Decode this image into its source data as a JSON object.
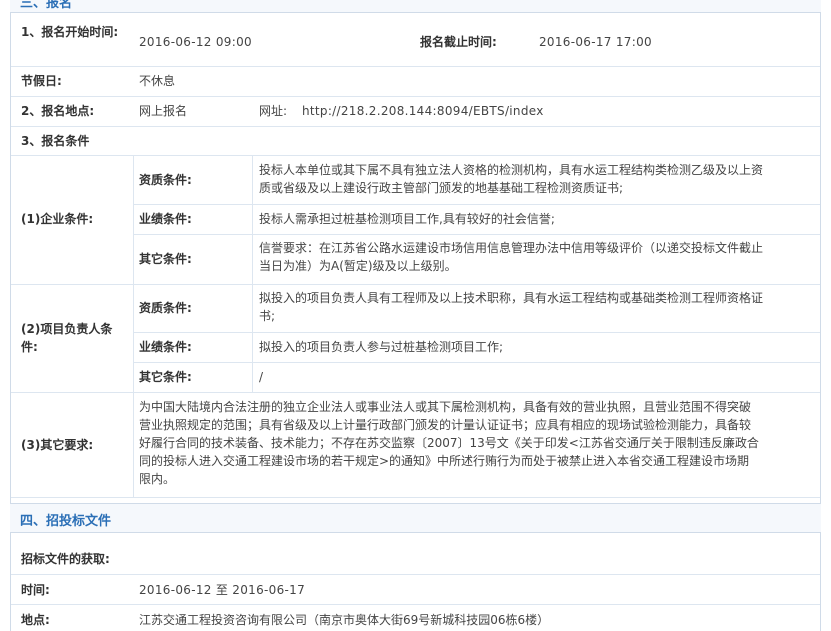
{
  "section3": {
    "title": "三、报名"
  },
  "reg_start": {
    "label": "1、报名开始时间:",
    "value": "2016-06-12 09:00"
  },
  "reg_end": {
    "label": "报名截止时间:",
    "value": "2016-06-17 17:00"
  },
  "holiday": {
    "label": "节假日:",
    "value": "不休息"
  },
  "reg_place": {
    "label": "2、报名地点:",
    "value": "网上报名",
    "url_label": "网址:",
    "url": "http://218.2.208.144:8094/EBTS/index"
  },
  "reg_cond": {
    "label": "3、报名条件"
  },
  "enterprise": {
    "label": "(1)企业条件:",
    "qual_label": "资质条件:",
    "qual_lines": [
      "投标人本单位或其下属不具有独立法人资格的检测机构，具有水运工程结构类检测乙级及以上资",
      "质或省级及以上建设行政主管部门颁发的地基基础工程检测资质证书;"
    ],
    "perf_label": "业绩条件:",
    "perf_value": "投标人需承担过桩基检测项目工作,具有较好的社会信誉;",
    "other_label": "其它条件:",
    "other_lines": [
      "信誉要求：在江苏省公路水运建设市场信用信息管理办法中信用等级评价（以递交投标文件截止",
      "当日为准）为A(暂定)级及以上级别。"
    ]
  },
  "manager": {
    "label_lines": [
      "(2)项目负责人条",
      "件:"
    ],
    "qual_label": "资质条件:",
    "qual_lines": [
      "拟投入的项目负责人具有工程师及以上技术职称，具有水运工程结构或基础类检测工程师资格证",
      "书;"
    ],
    "perf_label": "业绩条件:",
    "perf_value": "拟投入的项目负责人参与过桩基检测项目工作;",
    "other_label": "其它条件:",
    "other_value": "/"
  },
  "other_req": {
    "label": "(3)其它要求:",
    "lines": [
      "为中国大陆境内合法注册的独立企业法人或事业法人或其下属检测机构，具备有效的营业执照，且营业范围不得突破",
      "营业执照规定的范围；具有省级及以上计量行政部门颁发的计量认证证书；应具有相应的现场试验检测能力，具备较",
      "好履行合同的技术装备、技术能力；不存在苏交监察〔2007〕13号文《关于印发<江苏省交通厅关于限制违反廉政合",
      "同的投标人进入交通工程建设市场的若干规定>的通知》中所述行贿行为而处于被禁止进入本省交通工程建设市场期",
      "限内。"
    ]
  },
  "section4": {
    "title": "四、招投标文件"
  },
  "doc_obtain": {
    "label": "招标文件的获取:"
  },
  "doc_time": {
    "label": "时间:",
    "value": "2016-06-12 至 2016-06-17"
  },
  "doc_place": {
    "label": "地点:",
    "value": "江苏交通工程投资咨询有限公司（南京市奥体大街69号新城科技园06栋6楼）"
  }
}
